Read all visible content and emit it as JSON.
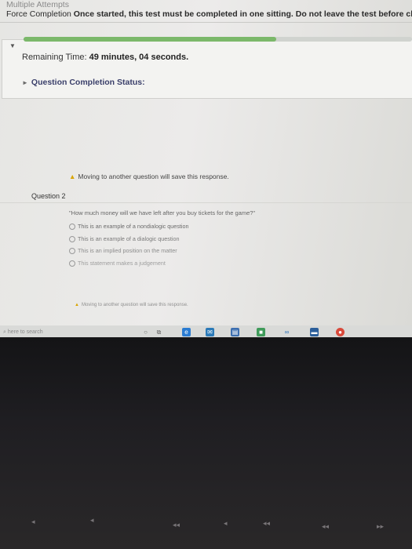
{
  "header": {
    "multiple_attempts": "Multiple Attempts",
    "force_completion_label": "Force Completion",
    "force_completion_text": "Once started, this test must be completed in one sitting. Do not leave the test before clicking"
  },
  "status": {
    "progress_percent": 65,
    "remaining_label": "Remaining Time:",
    "remaining_value": "49 minutes, 04 seconds.",
    "completion_status_label": "Question Completion Status:"
  },
  "question": {
    "warning_top": "Moving to another question will save this response.",
    "title": "Question 2",
    "prompt": "\"How much money will we have left after you buy tickets for the game?\"",
    "options": [
      "This is an example of a nondialogic question",
      "This is an example of a dialogic question",
      "This is an implied position on the matter",
      "This statement makes a judgement"
    ],
    "warning_bottom": "Moving to another question will save this response."
  },
  "taskbar": {
    "search_placeholder": "here to search"
  },
  "colors": {
    "progress": "#7bb86a",
    "warning_icon": "#d9a400",
    "status_label": "#3a3f6a"
  },
  "icons": [
    "warning-icon",
    "collapse-arrow-icon",
    "search-icon",
    "cortana-icon",
    "task-view-icon",
    "edge-icon",
    "store-icon",
    "onedrive-icon",
    "chrome-icon"
  ]
}
